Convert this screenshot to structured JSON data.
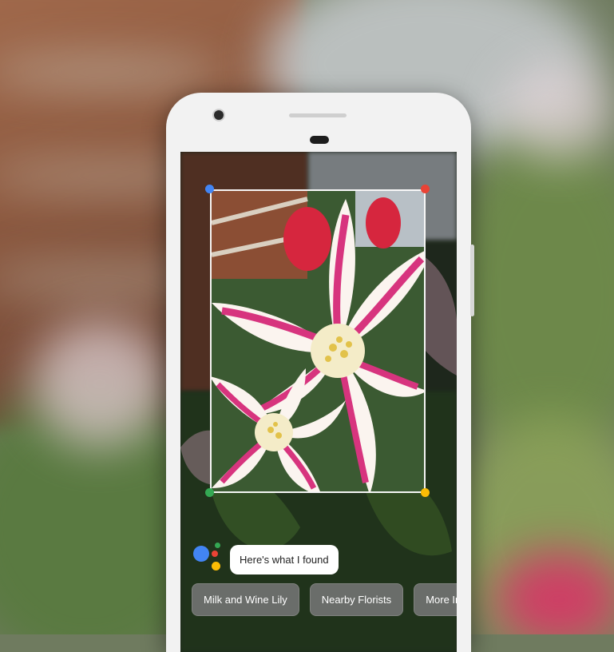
{
  "assistant": {
    "response_text": "Here's what I found",
    "logo_colors": [
      "#4285F4",
      "#EA4335",
      "#FBBC05",
      "#34A853"
    ]
  },
  "suggestions": [
    {
      "label": "Milk and Wine Lily"
    },
    {
      "label": "Nearby Florists"
    },
    {
      "label": "More In"
    }
  ],
  "crop_box": {
    "corner_colors": [
      "#4285F4",
      "#EA4335",
      "#34A853",
      "#FBBC05"
    ]
  },
  "colors": {
    "phone_body": "#f2f2f2",
    "chip_background": "#787878",
    "bubble_background": "#ffffff"
  }
}
